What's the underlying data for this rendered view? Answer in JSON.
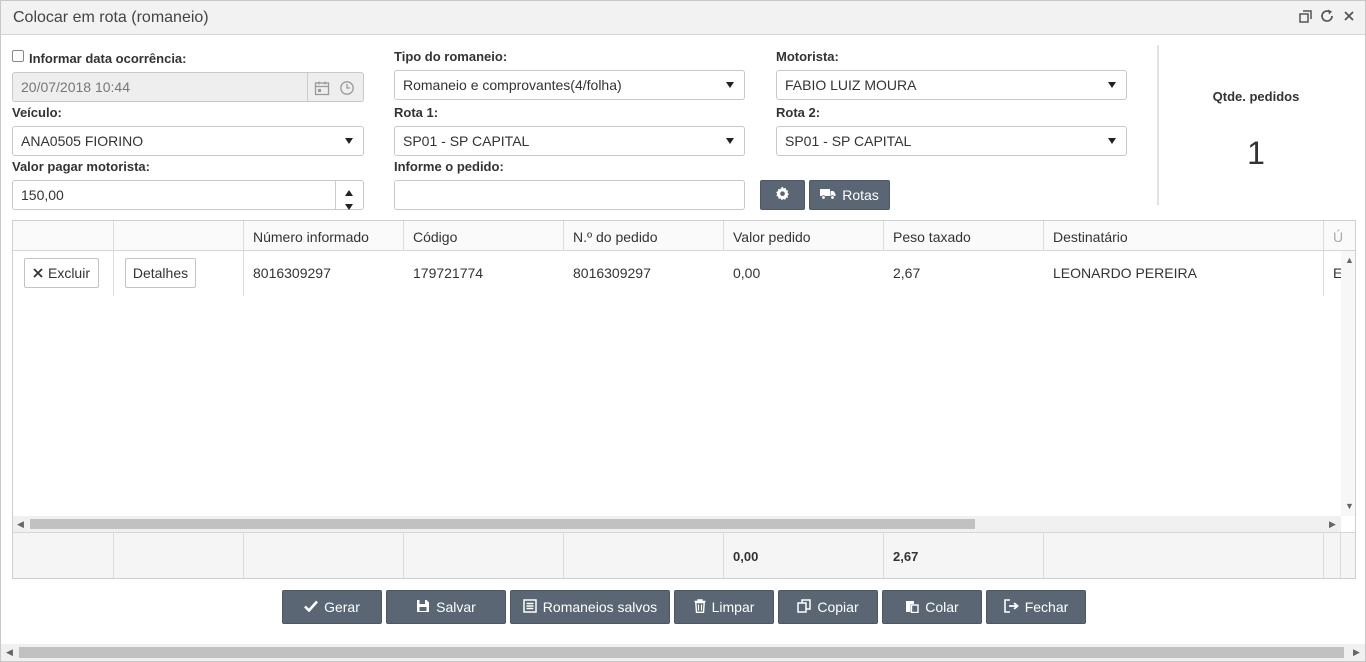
{
  "window": {
    "title": "Colocar em rota (romaneio)"
  },
  "form": {
    "informar_data_label": "Informar data ocorrência:",
    "informar_data_checked": false,
    "data_value": "20/07/2018 10:44",
    "tipo_label": "Tipo do romaneio:",
    "tipo_value": "Romaneio e comprovantes(4/folha)",
    "motorista_label": "Motorista:",
    "motorista_value": "FABIO LUIZ MOURA",
    "veiculo_label": "Veículo:",
    "veiculo_value": "ANA0505 FIORINO",
    "rota1_label": "Rota 1:",
    "rota1_value": "SP01 - SP CAPITAL",
    "rota2_label": "Rota 2:",
    "rota2_value": "SP01 - SP CAPITAL",
    "valor_label": "Valor pagar motorista:",
    "valor_value": "150,00",
    "pedido_label": "Informe o pedido:",
    "pedido_value": "",
    "rotas_label": "Rotas"
  },
  "summary": {
    "label": "Qtde. pedidos",
    "value": "1"
  },
  "grid": {
    "columns": [
      "",
      "",
      "Número informado",
      "Código",
      "N.º do pedido",
      "Valor pedido",
      "Peso taxado",
      "Destinatário",
      "Ú"
    ],
    "rows": [
      {
        "excluir": "Excluir",
        "detalhes": "Detalhes",
        "numero_informado": "8016309297",
        "codigo": "179721774",
        "numero_pedido": "8016309297",
        "valor_pedido": "0,00",
        "peso_taxado": "2,67",
        "destinatario": "LEONARDO PEREIRA",
        "ultimo": "E"
      }
    ],
    "totals": {
      "valor_pedido": "0,00",
      "peso_taxado": "2,67"
    }
  },
  "actions": {
    "gerar": "Gerar",
    "salvar": "Salvar",
    "romaneios_salvos": "Romaneios salvos",
    "limpar": "Limpar",
    "copiar": "Copiar",
    "colar": "Colar",
    "fechar": "Fechar"
  },
  "colors": {
    "button_dark": "#5a6673",
    "titlebar": "#f2f2f2"
  }
}
